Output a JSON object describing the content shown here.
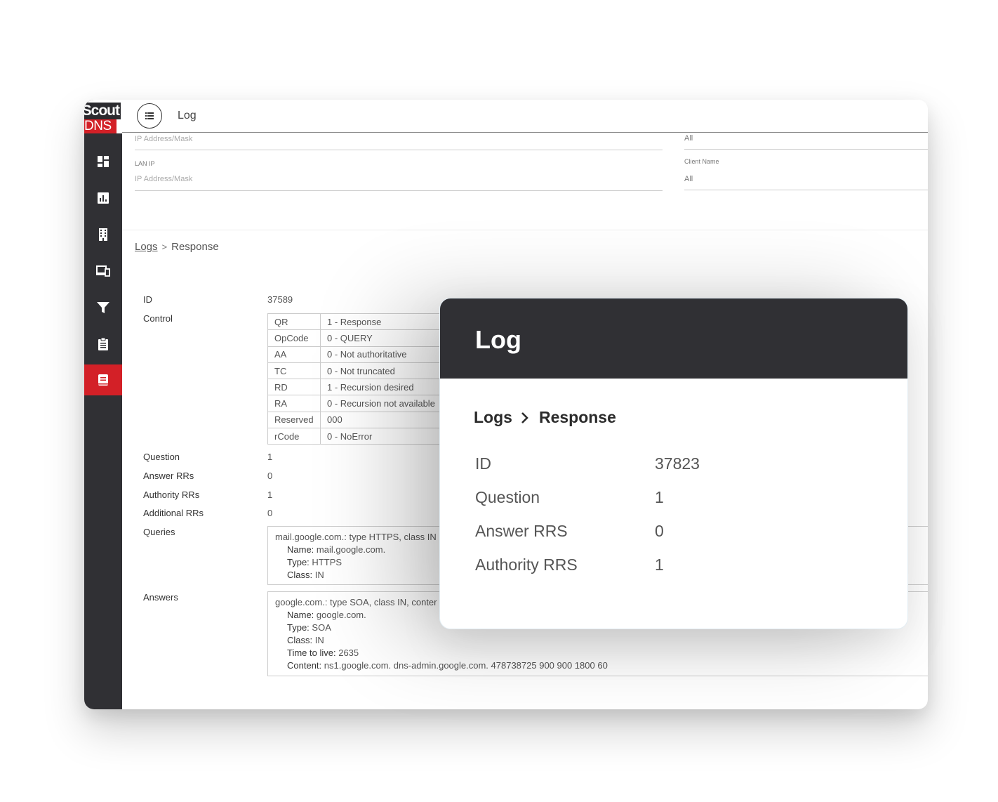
{
  "logo": {
    "line1": "Scout",
    "line2": "DNS"
  },
  "sidebar": {
    "items": [
      {
        "icon": "dashboard-icon"
      },
      {
        "icon": "reports-icon"
      },
      {
        "icon": "building-icon"
      },
      {
        "icon": "devices-icon"
      },
      {
        "icon": "filter-icon"
      },
      {
        "icon": "clipboard-icon"
      },
      {
        "icon": "logbook-icon",
        "active": true
      }
    ],
    "accent": "#d32027",
    "background": "#303034"
  },
  "header": {
    "title": "Log"
  },
  "filters": {
    "wan_ip_placeholder": "IP Address/Mask",
    "wan_right_value": "All",
    "lan_ip_label": "LAN IP",
    "lan_ip_placeholder": "IP Address/Mask",
    "client_name_label": "Client Name",
    "client_name_value": "All"
  },
  "breadcrumb": {
    "root": "Logs",
    "sep": ">",
    "current": "Response"
  },
  "details": {
    "id_label": "ID",
    "id_value": "37589",
    "control_label": "Control",
    "control": [
      {
        "k": "QR",
        "v": "1 - Response"
      },
      {
        "k": "OpCode",
        "v": "0 - QUERY"
      },
      {
        "k": "AA",
        "v": "0 - Not authoritative"
      },
      {
        "k": "TC",
        "v": "0 - Not truncated"
      },
      {
        "k": "RD",
        "v": "1 - Recursion desired"
      },
      {
        "k": "RA",
        "v": "0 - Recursion not available"
      },
      {
        "k": "Reserved",
        "v": "000"
      },
      {
        "k": "rCode",
        "v": "0 - NoError"
      }
    ],
    "question_label": "Question",
    "question_value": "1",
    "answer_label": "Answer RRs",
    "answer_value": "0",
    "authority_label": "Authority RRs",
    "authority_value": "1",
    "additional_label": "Additional RRs",
    "additional_value": "0",
    "queries_label": "Queries",
    "queries": {
      "head": "mail.google.com.: type HTTPS, class IN",
      "name_k": "Name:",
      "name_v": "mail.google.com.",
      "type_k": "Type:",
      "type_v": "HTTPS",
      "class_k": "Class:",
      "class_v": "IN"
    },
    "answers_label": "Answers",
    "answers": {
      "head": "google.com.: type SOA, class IN, conter",
      "name_k": "Name:",
      "name_v": "google.com.",
      "type_k": "Type:",
      "type_v": "SOA",
      "class_k": "Class:",
      "class_v": "IN",
      "ttl_k": "Time to live:",
      "ttl_v": "2635",
      "content_k": "Content:",
      "content_v": "ns1.google.com. dns-admin.google.com. 478738725 900 900 1800 60"
    }
  },
  "card": {
    "title": "Log",
    "crumb_root": "Logs",
    "crumb_current": "Response",
    "rows": [
      {
        "label": "ID",
        "value": "37823"
      },
      {
        "label": "Question",
        "value": "1"
      },
      {
        "label": "Answer RRS",
        "value": "0"
      },
      {
        "label": "Authority RRS",
        "value": "1"
      }
    ]
  }
}
